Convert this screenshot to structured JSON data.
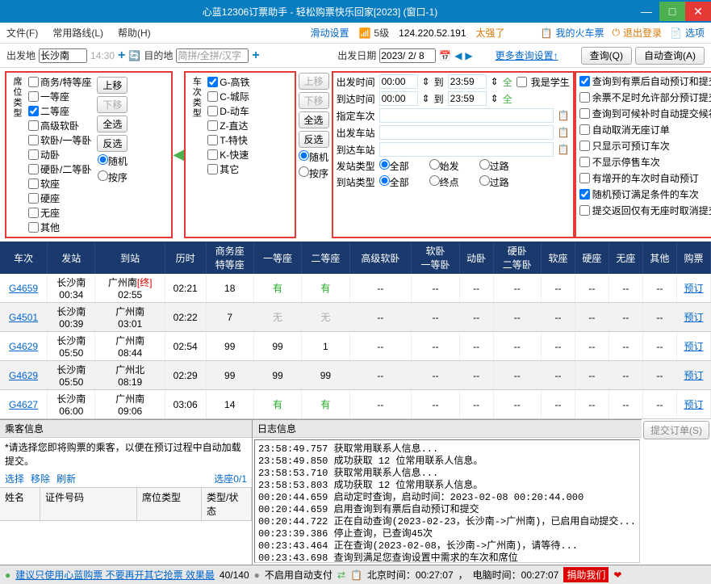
{
  "title": "心蓝12306订票助手 - 轻松购票快乐回家[2023] (窗口-1)",
  "menu": {
    "file": "文件(F)",
    "route": "常用路线(L)",
    "help": "帮助(H)",
    "slide": "滑动设置",
    "signal": "5级",
    "ip": "124.220.52.191",
    "strong": "太强了",
    "myticket": "我的火车票",
    "logout": "退出登录",
    "options": "选项"
  },
  "search": {
    "from_lbl": "出发地",
    "from": "长沙南",
    "from_time": "14:30",
    "to_lbl": "目的地",
    "to": "简拼/全拼/汉字",
    "date_lbl": "出发日期",
    "date": "2023/ 2/ 8",
    "more": "更多查询设置↑",
    "query": "查询(Q)",
    "auto_query": "自动查询(A)"
  },
  "seat_label": "席位类型",
  "seats": [
    "商务/特等座",
    "一等座",
    "二等座",
    "高级软卧",
    "软卧/一等卧",
    "动卧",
    "硬卧/二等卧",
    "软座",
    "硬座",
    "无座",
    "其他"
  ],
  "seat_checked": [
    false,
    false,
    true,
    false,
    false,
    false,
    false,
    false,
    false,
    false,
    false
  ],
  "train_label": "车次类型",
  "trains_t": [
    "G-高铁",
    "C-城际",
    "D-动车",
    "Z-直达",
    "T-特快",
    "K-快速",
    "其它"
  ],
  "train_checked": [
    true,
    false,
    false,
    false,
    false,
    false,
    false
  ],
  "btns": {
    "up": "上移",
    "down": "下移",
    "all": "全选",
    "inv": "反选",
    "rand": "随机",
    "order": "按序"
  },
  "mid": {
    "dep_time": "出发时间",
    "arr_time": "到达时间",
    "to": "到",
    "t1": "00:00",
    "t2": "23:59",
    "student": "我是学生",
    "spec_train": "指定车次",
    "dep_sta": "出发车站",
    "arr_sta": "到达车站",
    "dep_type": "发站类型",
    "arr_type": "到站类型",
    "all_r": "全部",
    "start": "始发",
    "end": "终点",
    "pass": "过路"
  },
  "opts": [
    "查询到有票后自动预订和提交",
    "余票不足时允许部分预订提交",
    "查询到可候补时自动提交候补",
    "自动取消无座订单",
    "只显示可预订车次",
    "不显示停售车次",
    "有增开的车次时自动预订",
    "随机预订满足条件的车次",
    "提交返回仅有无座时取消提交"
  ],
  "opts_checked": [
    true,
    false,
    false,
    false,
    false,
    false,
    false,
    true,
    false
  ],
  "th": [
    "车次",
    "发站",
    "到站",
    "历时",
    "商务座\n特等座",
    "一等座",
    "二等座",
    "高级软卧",
    "软卧\n一等卧",
    "动卧",
    "硬卧\n二等卧",
    "软座",
    "硬座",
    "无座",
    "其他",
    "购票"
  ],
  "rows": [
    {
      "no": "G4659",
      "dep": "长沙南",
      "dt": "00:34",
      "arr": "广州南",
      "at": "02:55",
      "arr_term": "[终]",
      "dur": "02:21",
      "biz": "18",
      "c1": "有",
      "c2": "有",
      "sr": "--",
      "s1": "--",
      "dw": "--",
      "h2": "--",
      "rz": "--",
      "yz": "--",
      "wz": "--",
      "qt": "--",
      "book": "预订"
    },
    {
      "no": "G4501",
      "dep": "长沙南",
      "dt": "00:39",
      "arr": "广州南",
      "at": "03:01",
      "dur": "02:22",
      "biz": "7",
      "c1": "无",
      "c2": "无",
      "sr": "--",
      "s1": "--",
      "dw": "--",
      "h2": "--",
      "rz": "--",
      "yz": "--",
      "wz": "--",
      "qt": "--",
      "book": "预订"
    },
    {
      "no": "G4629",
      "dep": "长沙南",
      "dt": "05:50",
      "arr": "广州南",
      "at": "08:44",
      "dur": "02:54",
      "biz": "99",
      "c1": "99",
      "c2": "1",
      "sr": "--",
      "s1": "--",
      "dw": "--",
      "h2": "--",
      "rz": "--",
      "yz": "--",
      "wz": "--",
      "qt": "--",
      "book": "预订"
    },
    {
      "no": "G4629",
      "dep": "长沙南",
      "dt": "05:50",
      "arr": "广州北",
      "at": "08:19",
      "dur": "02:29",
      "biz": "99",
      "c1": "99",
      "c2": "99",
      "sr": "--",
      "s1": "--",
      "dw": "--",
      "h2": "--",
      "rz": "--",
      "yz": "--",
      "wz": "--",
      "qt": "--",
      "book": "预订"
    },
    {
      "no": "G4627",
      "dep": "长沙南",
      "dt": "06:00",
      "arr": "广州南",
      "at": "09:06",
      "dur": "03:06",
      "biz": "14",
      "c1": "有",
      "c2": "有",
      "sr": "--",
      "s1": "--",
      "dw": "--",
      "h2": "--",
      "rz": "--",
      "yz": "--",
      "wz": "--",
      "qt": "--",
      "book": "预订"
    }
  ],
  "pass": {
    "title": "乘客信息",
    "hint": "*请选择您即将购票的乘客，以便在预订过程中自动加载提交。",
    "sel": "选择",
    "del": "移除",
    "ref": "刷新",
    "seat": "选座0/1",
    "name": "姓名",
    "id": "证件号码",
    "type": "席位类型",
    "stat": "类型/状态"
  },
  "log": {
    "title": "日志信息",
    "submit": "提交订单(S)",
    "lines": [
      "23:58:49.757 获取常用联系人信息...",
      "23:58:49.850 成功获取 12 位常用联系人信息。",
      "23:58:53.710 获取常用联系人信息...",
      "23:58:53.803 成功获取 12 位常用联系人信息。",
      "00:20:44.659 启动定时查询，启动时间：2023-02-08 00:20:44.000",
      "00:20:44.659 启用查询到有票后自动预订和提交",
      "00:20:44.722 正在自动查询(2023-02-23，长沙南->广州南)，已启用自动提交...",
      "00:23:39.386 停止查询，已查询45次",
      "00:23:43.464 正在查询(2023-02-08，长沙南->广州南)，请等待...",
      "00:23:43.698 查询到满足您查询设置中需求的车次和席位"
    ]
  },
  "status": {
    "tip": "建议只使用心蓝购票 不要再开其它抢票 效果最",
    "count": "40/140",
    "nopay": "不启用自动支付",
    "bjtime": "北京时间：00:27:07",
    "pctime": "电脑时间：00:27:07",
    "donate": "捐助我们"
  }
}
